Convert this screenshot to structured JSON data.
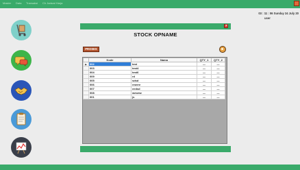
{
  "menu": {
    "items": [
      "Master",
      "Data",
      "Transaksi",
      "Ch Jadwal Harja"
    ]
  },
  "header": {
    "datetime": "03 : 11 : 06  Sunday 24 July 20",
    "user": "user"
  },
  "sidebar": {
    "icons": [
      "trolley-icon",
      "chat-icon",
      "handshake-icon",
      "clipboard-icon",
      "chart-icon"
    ]
  },
  "panel": {
    "title": "STOCK OPNAME",
    "proses_label": "PROSES"
  },
  "grid": {
    "columns": [
      "Kode",
      "Nama",
      "QTY_1",
      "QTY_2"
    ],
    "rows": [
      {
        "kode": "002",
        "nama": "test",
        "q1": "—",
        "q2": "—"
      },
      {
        "kode": "003",
        "nama": "test4",
        "q1": "—",
        "q2": "—"
      },
      {
        "kode": "004",
        "nama": "test6",
        "q1": "—",
        "q2": "—"
      },
      {
        "kode": "009",
        "nama": "rd",
        "q1": "—",
        "q2": "—"
      },
      {
        "kode": "005",
        "nama": "sdsd",
        "q1": "—",
        "q2": "—"
      },
      {
        "kode": "006",
        "nama": "rewrre",
        "q1": "—",
        "q2": "—"
      },
      {
        "kode": "007",
        "nama": "eedsd",
        "q1": "—",
        "q2": "—"
      },
      {
        "kode": "008",
        "nama": "wewew",
        "q1": "—",
        "q2": "—"
      },
      {
        "kode": "001",
        "nama": "js",
        "q1": "—",
        "q2": "—"
      }
    ]
  },
  "colors": {
    "green": "#3aaa6a",
    "proses": "#b3542d",
    "selection": "#2f7ed8"
  }
}
